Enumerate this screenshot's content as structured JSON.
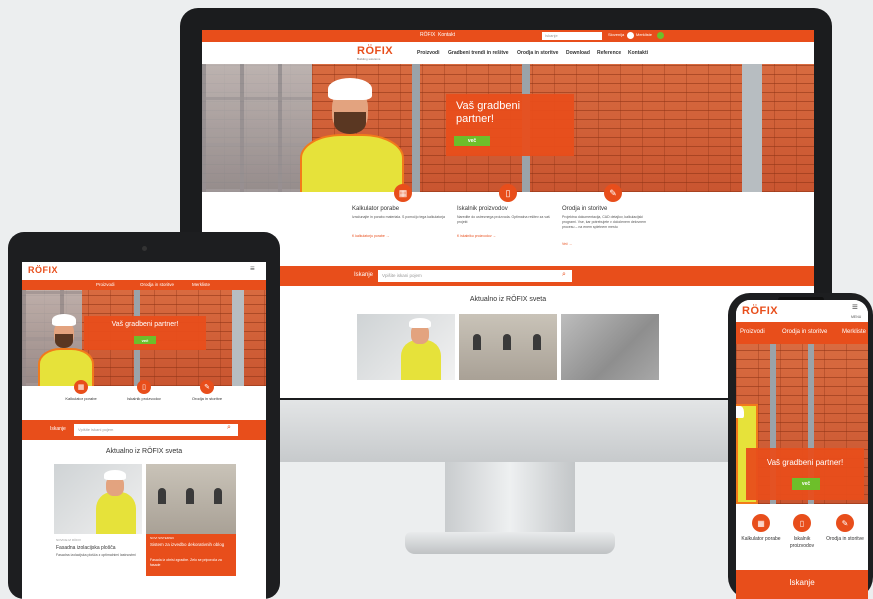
{
  "site": {
    "logo_text": "RÖFIX",
    "logo_sub": "Building solutions",
    "accent": "#e84e1b",
    "button_green": "#6dbf2a"
  },
  "desktop": {
    "topbar": {
      "links": [
        "RÖFIX",
        "Kontakt"
      ],
      "search_placeholder": "Iskanje",
      "lang": "Slovenija",
      "watchlist": "Merkliste"
    },
    "nav": [
      "Proizvodi",
      "Gradbeni trendi in rešitve",
      "Orodja in storitve",
      "Download",
      "Reference",
      "Kontakti"
    ],
    "hero": {
      "title": "Vaš gradbeni partner!",
      "button": "več"
    },
    "features": [
      {
        "icon": "calculator-icon",
        "title": "Kalkulator porabe",
        "text": "Izračunajte in porabo materiala. S pomočjo tega kalkulatorja",
        "link": "K kalkulatorju porabe →"
      },
      {
        "icon": "phone-icon",
        "title": "Iskalnik proizvodov",
        "text": "Naredite do ustreznega proizvoda. Optimalna rešitev za vaš projekt",
        "link": "K iskalniku proizvodov →"
      },
      {
        "icon": "tools-icon",
        "title": "Orodja in storitve",
        "text": "Projektna dokumentacija, CAD detajlov, kalkulacijski programi. Vse, kar potrebujete v določenem delovnem procesu – na enem spletnem mestu",
        "link": "Več →"
      }
    ],
    "search": {
      "label": "Iskanje",
      "placeholder": "Vpišite iskani pojem"
    },
    "news_title": "Aktualno iz RÖFIX sveta"
  },
  "tablet": {
    "nav": [
      "Proizvodi",
      "Orodja in storitve",
      "Merkliste"
    ],
    "hero": {
      "title": "Vaš gradbeni partner!",
      "button": "več"
    },
    "features": [
      "Kalkulator porabe",
      "Iskalnik proizvodov",
      "Orodja in storitve"
    ],
    "search": {
      "label": "Iskanje",
      "placeholder": "Vpišite iskani pojem"
    },
    "news_title": "Aktualno iz RÖFIX sveta",
    "cards": [
      {
        "kicker": "NOVICE IZ RÖFIX",
        "title": "Fasadna izolacijska plošča",
        "text": "Fasadna izolacijska plošča z optimalnimi lastnostmi"
      },
      {
        "kicker": "NOVI SISTEMSKI",
        "title": "Sistem za izvedbo dekorativnih oblog",
        "text": "Fasada iz obrisi zgradbe. Zelo se priporoča za fasade"
      }
    ]
  },
  "phone": {
    "nav": [
      "Proizvodi",
      "Orodja in storitve",
      "Merkliste"
    ],
    "menu_label": "MENU",
    "hero": {
      "title": "Vaš gradbeni partner!",
      "button": "več"
    },
    "features": [
      "Kalkulator porabe",
      "Iskalnik proizvodov",
      "Orodja in storitve"
    ],
    "search_label": "Iskanje"
  }
}
